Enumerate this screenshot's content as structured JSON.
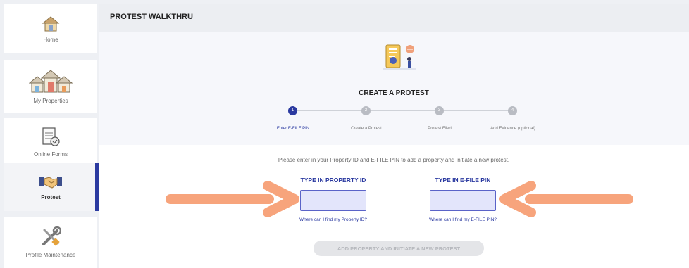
{
  "sidebar": {
    "items": [
      {
        "label": "Home",
        "icon": "home-icon"
      },
      {
        "label": "My Properties",
        "icon": "houses-icon"
      },
      {
        "label": "Online Forms",
        "icon": "forms-icon"
      },
      {
        "label": "Protest",
        "icon": "handshake-icon",
        "active": true
      },
      {
        "label": "Profile Maintenance",
        "icon": "tools-icon"
      }
    ]
  },
  "header": {
    "title": "PROTEST WALKTHRU"
  },
  "main": {
    "create_title": "CREATE A PROTEST",
    "steps": [
      {
        "number": "1",
        "label": "Enter E-FILE PIN",
        "active": true
      },
      {
        "number": "2",
        "label": "Create a Protest"
      },
      {
        "number": "3",
        "label": "Protest Filed"
      },
      {
        "number": "4",
        "label": "Add Evidence (optional)"
      }
    ],
    "instructions": "Please enter in your Property ID and E-FILE PIN to add a property and initiate a new protest.",
    "property_id": {
      "title": "TYPE IN PROPERTY ID",
      "value": "",
      "help": "Where can I find my Property ID?"
    },
    "efile_pin": {
      "title": "TYPE IN E-FILE PIN",
      "value": "",
      "help": "Where can I find my E-FILE PIN?"
    },
    "submit_label": "ADD PROPERTY AND INITIATE A NEW PROTEST"
  },
  "colors": {
    "accent": "#2b3aa0",
    "input_fill": "#e3e5fb",
    "annotation_arrow": "#f7a47c"
  }
}
